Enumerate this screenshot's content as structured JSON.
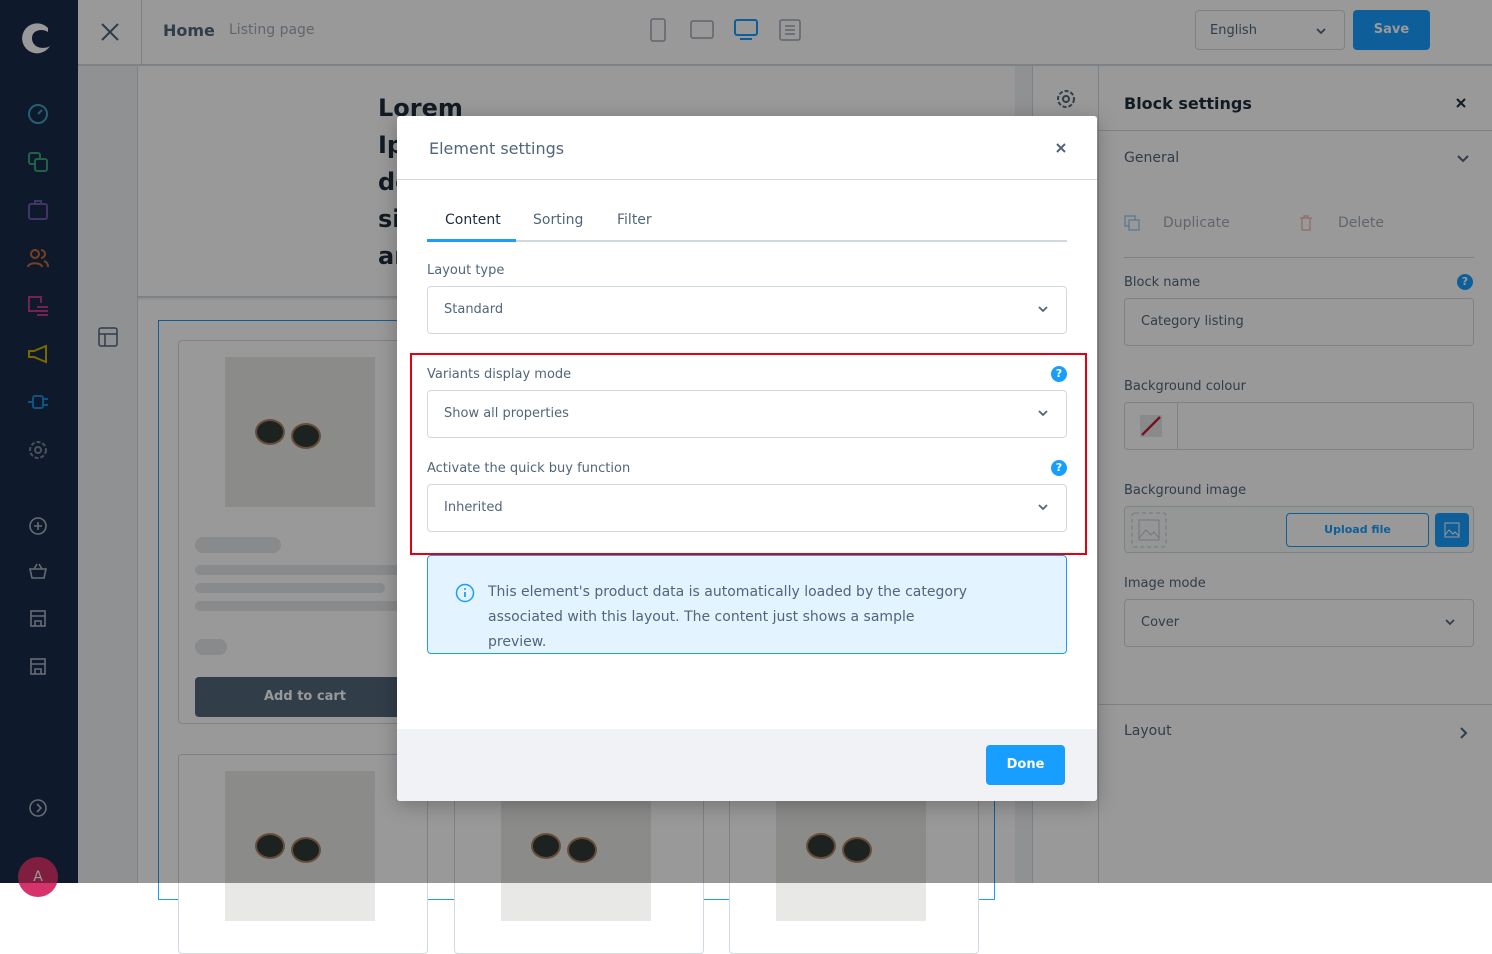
{
  "topbar": {
    "title": "Home",
    "subtitle": "Listing page",
    "language": "English",
    "save_label": "Save"
  },
  "canvas": {
    "heading_lines": [
      "Lorem",
      "Ip",
      "do",
      "si",
      "ar"
    ],
    "add_to_cart": "Add to cart"
  },
  "sidebar": {
    "avatar_initial": "A",
    "icons": [
      "dashboard-icon",
      "catalogue-icon",
      "orders-icon",
      "customers-icon",
      "content-icon",
      "marketing-icon",
      "extensions-icon",
      "settings-icon"
    ],
    "colors": [
      "#3d9fbf",
      "#37a279",
      "#6a5aa8",
      "#c9693a",
      "#c23a8a",
      "#c9b000",
      "#1b8ad8",
      "#7a8899"
    ]
  },
  "right_panel": {
    "title": "Block settings",
    "general": "General",
    "duplicate": "Duplicate",
    "delete": "Delete",
    "block_name_label": "Block name",
    "block_name_value": "Category listing",
    "bg_colour_label": "Background colour",
    "bg_image_label": "Background image",
    "upload_label": "Upload file",
    "image_mode_label": "Image mode",
    "image_mode_value": "Cover",
    "layout": "Layout"
  },
  "modal": {
    "title": "Element settings",
    "tabs": [
      {
        "label": "Content",
        "active": true
      },
      {
        "label": "Sorting"
      },
      {
        "label": "Filter"
      }
    ],
    "layout_type_label": "Layout type",
    "layout_type_value": "Standard",
    "variants_label": "Variants display mode",
    "variants_value": "Show all properties",
    "quickbuy_label": "Activate the quick buy function",
    "quickbuy_value": "Inherited",
    "info_text": "This element's product data is automatically loaded by the category associated with this layout. The content just shows a sample preview.",
    "done_label": "Done",
    "help_glyph": "?"
  },
  "colors": {
    "accent": "#189eff",
    "highlight": "#e3000f",
    "info_bg": "#e3f3ff"
  }
}
